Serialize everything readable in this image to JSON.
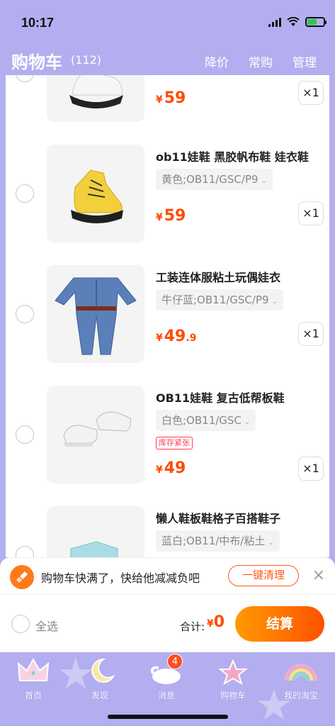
{
  "status": {
    "time": "10:17"
  },
  "header": {
    "title": "购物车",
    "count": "(112)",
    "actions": [
      "降价",
      "常购",
      "管理"
    ]
  },
  "items": [
    {
      "title": "",
      "sku": "",
      "badge": "",
      "price_currency": "¥",
      "price_int": "59",
      "price_dec": "",
      "qty": "×1"
    },
    {
      "title": "ob11娃鞋 黑胶帆布鞋 娃衣鞋",
      "sku": "黄色;OB11/GSC/P9",
      "badge": "",
      "price_currency": "¥",
      "price_int": "59",
      "price_dec": "",
      "qty": "×1"
    },
    {
      "title": "工装连体服粘土玩偶娃衣",
      "sku": "牛仔蓝;OB11/GSC/P9",
      "badge": "",
      "price_currency": "¥",
      "price_int": "49",
      "price_dec": ".9",
      "qty": "×1"
    },
    {
      "title": "OB11娃鞋 复古低帮板鞋",
      "sku": "白色;OB11/GSC",
      "badge": "库存紧张",
      "price_currency": "¥",
      "price_int": "49",
      "price_dec": "",
      "qty": "×1"
    },
    {
      "title": "懒人鞋板鞋格子百搭鞋子",
      "sku": "蓝白;OB11/中布/粘土",
      "badge": "",
      "price_currency": "¥",
      "price_int": "",
      "price_dec": "",
      "qty": ""
    }
  ],
  "notice": {
    "text": "购物车快满了，快给他减减负吧",
    "button": "一键清理",
    "close": "×"
  },
  "checkout": {
    "select_all": "全选",
    "total_label": "合计:",
    "total_currency": "¥",
    "total_value": "0",
    "button": "结算"
  },
  "tabs": [
    {
      "label": "首页",
      "icon": "crown-icon"
    },
    {
      "label": "发现",
      "icon": "moon-icon"
    },
    {
      "label": "消息",
      "icon": "wing-cloud-icon",
      "badge": "4"
    },
    {
      "label": "购物车",
      "icon": "star-icon"
    },
    {
      "label": "我的淘宝",
      "icon": "rainbow-icon"
    }
  ],
  "colors": {
    "accent": "#ff4b00",
    "header_bg": "#b3aeef",
    "badge": "#ff3d5b"
  }
}
